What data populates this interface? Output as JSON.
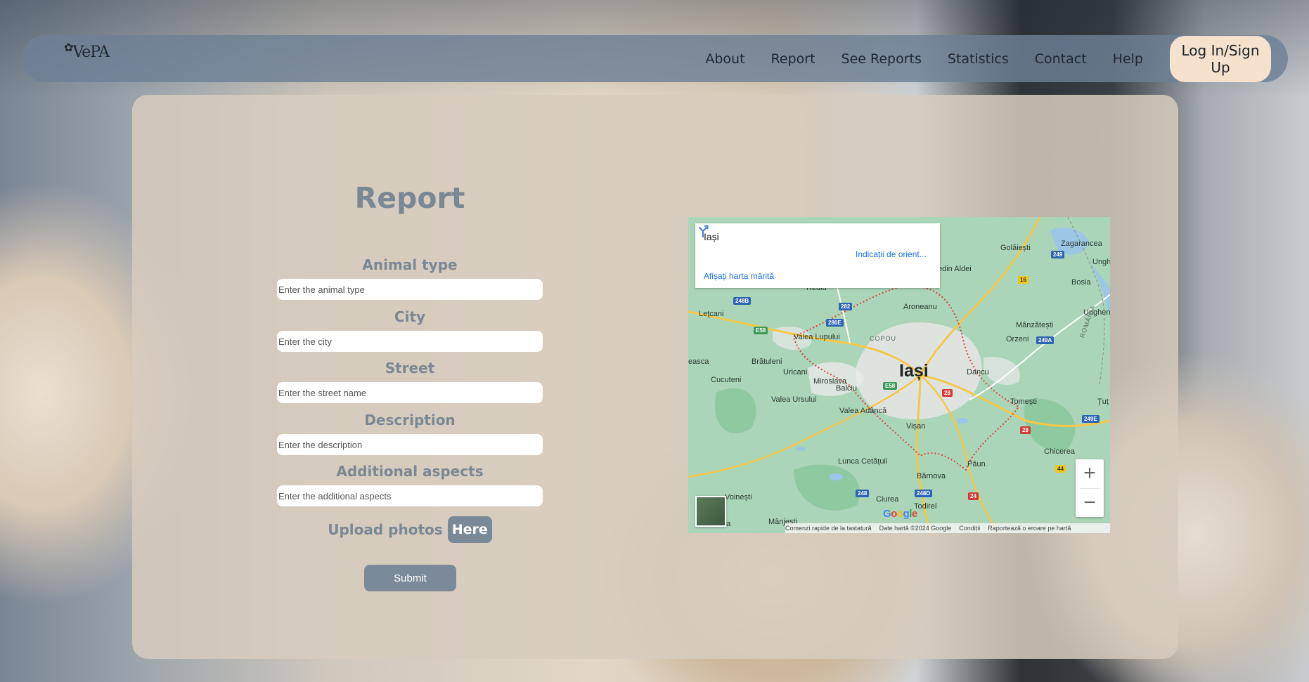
{
  "nav": {
    "logo_text": "VePA",
    "links": [
      "About",
      "Report",
      "See Reports",
      "Statistics",
      "Contact",
      "Help"
    ],
    "login_label": "Log In/Sign Up"
  },
  "form": {
    "title": "Report",
    "fields": [
      {
        "label": "Animal type",
        "placeholder": "Enter the animal type"
      },
      {
        "label": "City",
        "placeholder": "Enter the city"
      },
      {
        "label": "Street",
        "placeholder": "Enter the street name"
      },
      {
        "label": "Description",
        "placeholder": "Enter the description"
      },
      {
        "label": "Additional aspects",
        "placeholder": "Enter the additional aspects"
      }
    ],
    "upload_label": "Upload photos",
    "upload_button": "Here",
    "submit_label": "Submit"
  },
  "map": {
    "card_title": "Iași",
    "directions_label": "Indicații de orient...",
    "larger_map_label": "Afișați harta mărită",
    "city_label": "Iași",
    "places": [
      "Golăiești",
      "Zagarancea",
      "Ungh",
      "Bosia",
      "Unghen",
      "Mânzătești",
      "Orzeni",
      "Aroneanu",
      "Leţcani",
      "Valea Lupului",
      "COPOU",
      "Brătuleni",
      "Uricani",
      "Miroslava",
      "Dancu",
      "Cucuteni",
      "Valea Ursului",
      "Balciu",
      "Tomești",
      "Valea Adâncă",
      "Vișan",
      "Țuț",
      "Chicerea",
      "Lunca Cetățuii",
      "Păun",
      "Bârnova",
      "Voinești",
      "Ciurea",
      "Todirel",
      "Mânjești",
      "Slobozia",
      "edin Aldei",
      "Rediu",
      "easca",
      "ROMÂNIA"
    ],
    "road_badges": [
      "249",
      "16",
      "248B",
      "282",
      "280E",
      "E58",
      "249A",
      "E58",
      "28",
      "249E",
      "28",
      "44",
      "248",
      "248D",
      "24"
    ],
    "zoom_in": "+",
    "zoom_out": "−",
    "google_logo": "Google",
    "footer": [
      "Comenzi rapide de la tastatură",
      "Date hartă ©2024 Google",
      "Condiții",
      "Raportează o eroare pe hartă"
    ]
  },
  "colors": {
    "nav_bg": "#6e8096",
    "login_bg": "#f6e2cc",
    "panel_bg": "#d6ccbe",
    "accent": "#7a8795",
    "link_blue": "#1a73e8"
  }
}
